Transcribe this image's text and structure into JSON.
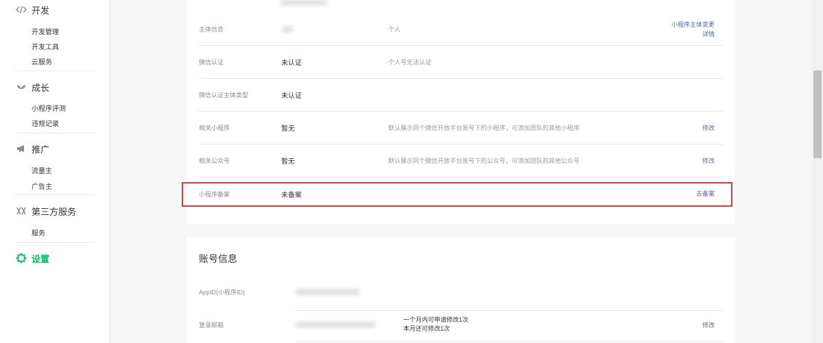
{
  "sidebar": {
    "groups": [
      {
        "icon": "code-icon",
        "title": "开发",
        "items": [
          "开发管理",
          "开发工具",
          "云服务"
        ]
      },
      {
        "icon": "sprout-icon",
        "title": "成长",
        "items": [
          "小程序评测",
          "违规记录"
        ]
      },
      {
        "icon": "megaphone-icon",
        "title": "推广",
        "items": [
          "流量主",
          "广告主"
        ]
      },
      {
        "icon": "third-party-icon",
        "title": "第三方服务",
        "items": [
          "服务"
        ]
      }
    ],
    "settings": {
      "icon": "gear-icon",
      "title": "设置"
    }
  },
  "basic_info": {
    "rows": [
      {
        "label": "主体信息",
        "value": "",
        "desc": "个人",
        "action": [
          "小程序主体变更",
          "详情"
        ]
      },
      {
        "label": "微信认证",
        "value": "未认证",
        "desc": "个人号无法认证",
        "action": []
      },
      {
        "label": "微信认证主体类型",
        "value": "未认证",
        "desc": "",
        "action": []
      },
      {
        "label": "相关小程序",
        "value": "暂无",
        "desc": "默认展示同个微信开放平台账号下的小程序，可添加团队的其他小程序",
        "action": [
          "修改"
        ]
      },
      {
        "label": "相关公众号",
        "value": "暂无",
        "desc": "默认展示同个微信开放平台账号下的公众号，可添加团队的其他公众号",
        "action": [
          "修改"
        ]
      },
      {
        "label": "小程序备案",
        "value": "未备案",
        "desc": "",
        "action": [
          "去备案"
        ]
      }
    ]
  },
  "account_info": {
    "title": "账号信息",
    "appid_label": "AppID(小程序ID)",
    "email_label": "登录邮箱",
    "email_note_1": "一个月内可申请修改1次",
    "email_note_2": "本月还可修改1次",
    "email_action": "修改"
  },
  "colors": {
    "accent": "#07c160",
    "link": "#576b95",
    "highlight": "#d6383a"
  }
}
